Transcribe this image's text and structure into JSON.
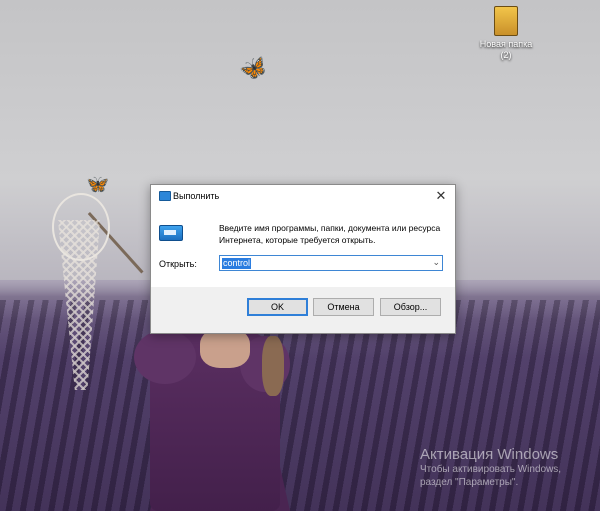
{
  "desktop": {
    "icons": [
      {
        "label_line1": "Новая папка",
        "label_line2": "(2)",
        "icon": "folder-icon"
      }
    ],
    "watermark": {
      "title": "Активация Windows",
      "line1": "Чтобы активировать Windows,",
      "line2": "раздел \"Параметры\"."
    }
  },
  "dialog": {
    "title": "Выполнить",
    "close_glyph": "✕",
    "description": "Введите имя программы, папки, документа или ресурса Интернета, которые требуется открыть.",
    "open_label": "Открыть:",
    "input_value": "control",
    "dropdown_glyph": "⌄",
    "buttons": {
      "ok": "OK",
      "cancel": "Отмена",
      "browse": "Обзор..."
    },
    "accent_color": "#2b7de0"
  },
  "decor": {
    "butterfly_glyph": "🦋"
  }
}
